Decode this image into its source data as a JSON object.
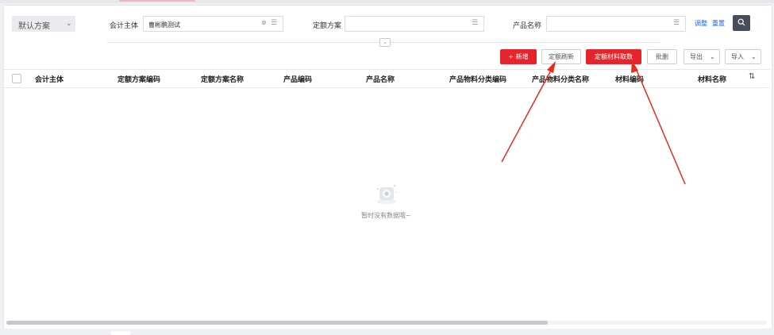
{
  "filter_bar": {
    "scheme_select": {
      "value": "默认方案"
    },
    "accounting_entity": {
      "label": "会计主体",
      "value": "曹彬鹏测试"
    },
    "quota_scheme": {
      "label": "定额方案",
      "value": ""
    },
    "product_name": {
      "label": "产品名称",
      "value": ""
    },
    "adjust_label": "调整",
    "reset_label": "重置"
  },
  "toolbar": {
    "add_label": "+ 新增",
    "quota_refresh_label": "定额刷新",
    "quota_material_fetch_label": "定额材料取数",
    "batch_delete_label": "批删",
    "export_label": "导出",
    "import_label": "导入"
  },
  "table": {
    "columns": [
      "会计主体",
      "定额方案编码",
      "定额方案名称",
      "产品编码",
      "产品名称",
      "产品物料分类编码",
      "产品物料分类名称",
      "材料编码",
      "材料名称"
    ],
    "rows": []
  },
  "empty_state": {
    "message": "暂时没有数据哦~",
    "icon": "empty-box-icon"
  },
  "icons": {
    "search": "search-icon",
    "list": "list-icon",
    "clear": "clear-icon",
    "collapse": "chevron-down-icon",
    "column_settings": "column-settings-icon"
  },
  "colors": {
    "primary_red": "#e5242b",
    "link_blue": "#1f5fd8",
    "search_button": "#474e5a",
    "annotation_arrow": "#e82a1f"
  }
}
